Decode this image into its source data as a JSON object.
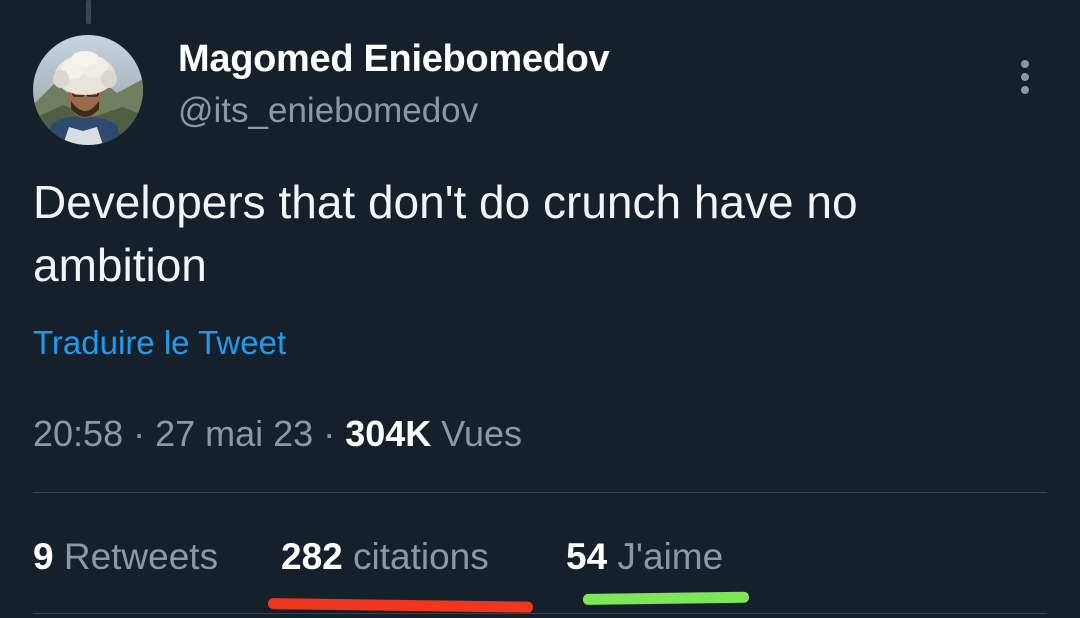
{
  "author": {
    "name": "Magomed Eniebomedov",
    "handle": "@its_eniebomedov"
  },
  "tweet": {
    "text": "Developers that don't do crunch have no ambition",
    "translate_label": "Traduire le Tweet"
  },
  "meta": {
    "time": "20:58",
    "separator": " · ",
    "date": "27 mai 23",
    "views_count": "304K",
    "views_label": " Vues"
  },
  "stats": {
    "retweets": {
      "count": "9",
      "label": " Retweets"
    },
    "quotes": {
      "count": "282",
      "label": " citations"
    },
    "likes": {
      "count": "54",
      "label": " J'aime"
    }
  },
  "icons": {
    "more": "more-vertical-icon"
  },
  "colors": {
    "background": "#16202b",
    "link": "#1d9bf0",
    "secondary_text": "#8b98a5",
    "annotation_red": "#f0361d",
    "annotation_green": "#7fe55a"
  }
}
